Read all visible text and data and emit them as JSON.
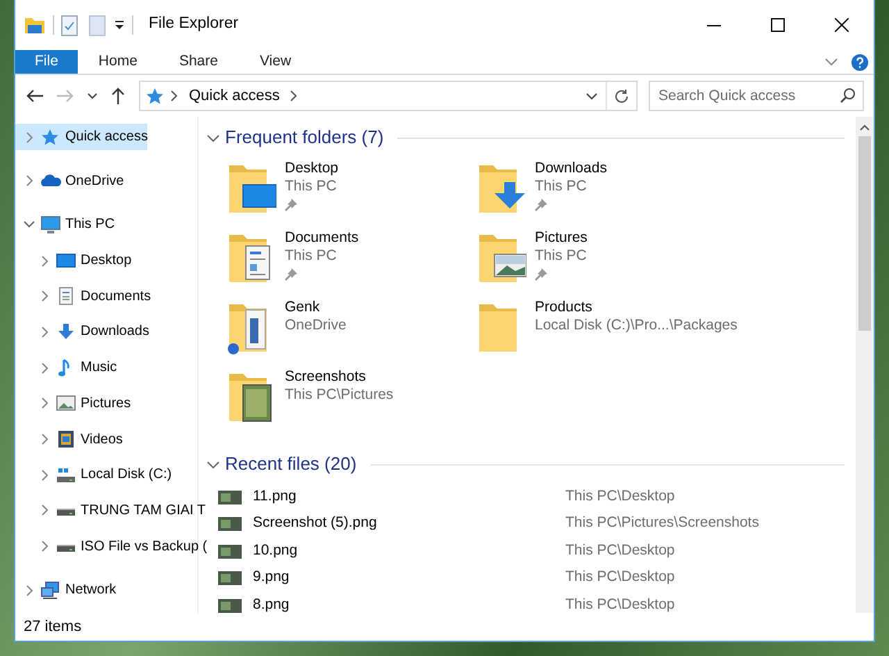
{
  "window": {
    "title": "File Explorer"
  },
  "ribbon_tabs": [
    {
      "label": "File",
      "selected": true
    },
    {
      "label": "Home",
      "selected": false
    },
    {
      "label": "Share",
      "selected": false
    },
    {
      "label": "View",
      "selected": false
    }
  ],
  "address_bar": {
    "path": [
      "Quick access"
    ]
  },
  "search": {
    "placeholder": "Search Quick access"
  },
  "navigation": [
    {
      "label": "Quick access",
      "kind": "star",
      "selected": true,
      "expanded": false
    },
    {
      "label": "OneDrive",
      "kind": "cloud",
      "selected": false,
      "expanded": false
    },
    {
      "label": "This PC",
      "kind": "computer",
      "selected": false,
      "expanded": true,
      "children": [
        {
          "label": "Desktop",
          "kind": "desktop",
          "selected": false,
          "expanded": false
        },
        {
          "label": "Documents",
          "kind": "documents",
          "selected": false,
          "expanded": false
        },
        {
          "label": "Downloads",
          "kind": "downloads",
          "selected": false,
          "expanded": false
        },
        {
          "label": "Music",
          "kind": "music",
          "selected": false,
          "expanded": false
        },
        {
          "label": "Pictures",
          "kind": "pictures",
          "selected": false,
          "expanded": false
        },
        {
          "label": "Videos",
          "kind": "videos",
          "selected": false,
          "expanded": false
        },
        {
          "label": "Local Disk (C:)",
          "kind": "system-drive",
          "selected": false,
          "expanded": false
        },
        {
          "label": "TRUNG TAM GIAI T",
          "kind": "drive",
          "selected": false,
          "expanded": false
        },
        {
          "label": "ISO File vs Backup (",
          "kind": "drive",
          "selected": false,
          "expanded": false
        }
      ]
    },
    {
      "label": "Network",
      "kind": "network",
      "selected": false,
      "expanded": false
    }
  ],
  "frequent_folders": {
    "title": "Frequent folders (7)",
    "expanded": true,
    "items": [
      {
        "name": "Desktop",
        "location": "This PC",
        "kind": "desktop",
        "pinned": true
      },
      {
        "name": "Downloads",
        "location": "This PC",
        "kind": "downloads",
        "pinned": true
      },
      {
        "name": "Documents",
        "location": "This PC",
        "kind": "documents",
        "pinned": true
      },
      {
        "name": "Pictures",
        "location": "This PC",
        "kind": "pictures",
        "pinned": true
      },
      {
        "name": "Genk",
        "location": "OneDrive",
        "kind": "synced",
        "pinned": false
      },
      {
        "name": "Products",
        "location": "Local Disk (C:)\\Pro...\\Packages",
        "kind": "plain",
        "pinned": false
      },
      {
        "name": "Screenshots",
        "location": "This PC\\Pictures",
        "kind": "photos",
        "pinned": false
      }
    ]
  },
  "recent_files": {
    "title": "Recent files (20)",
    "expanded": true,
    "items": [
      {
        "name": "11.png",
        "location": "This PC\\Desktop"
      },
      {
        "name": "Screenshot (5).png",
        "location": "This PC\\Pictures\\Screenshots"
      },
      {
        "name": "10.png",
        "location": "This PC\\Desktop"
      },
      {
        "name": "9.png",
        "location": "This PC\\Desktop"
      },
      {
        "name": "8.png",
        "location": "This PC\\Desktop"
      }
    ]
  },
  "status_bar": {
    "text": "27 items"
  }
}
